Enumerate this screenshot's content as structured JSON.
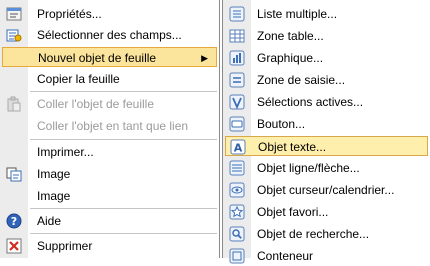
{
  "left_menu": {
    "items": [
      {
        "label": "Propriétés...",
        "icon": "properties-icon"
      },
      {
        "label": "Sélectionner des champs...",
        "icon": "select-fields-icon"
      },
      {
        "label": "Nouvel objet de feuille",
        "icon": "",
        "submenu_arrow": "▶"
      },
      {
        "label": "Copier la feuille",
        "icon": ""
      },
      {
        "label": "Coller l'objet de feuille",
        "icon": "paste-icon"
      },
      {
        "label": "Coller l'objet en tant que lien",
        "icon": ""
      },
      {
        "label": "Imprimer...",
        "icon": ""
      },
      {
        "label": "Image",
        "icon": "copy-image-icon"
      },
      {
        "label": "Image",
        "icon": ""
      },
      {
        "label": "Aide",
        "icon": "help-icon"
      },
      {
        "label": "Supprimer",
        "icon": "delete-icon"
      }
    ]
  },
  "right_menu": {
    "items": [
      {
        "label": "Liste multiple...",
        "icon": "multi-list-icon"
      },
      {
        "label": "Zone table...",
        "icon": "table-box-icon"
      },
      {
        "label": "Graphique...",
        "icon": "chart-icon"
      },
      {
        "label": "Zone de saisie...",
        "icon": "input-box-icon"
      },
      {
        "label": "Sélections actives...",
        "icon": "current-selections-icon"
      },
      {
        "label": "Bouton...",
        "icon": "button-icon"
      },
      {
        "label": "Objet texte...",
        "icon": "text-object-icon"
      },
      {
        "label": "Objet ligne/flèche...",
        "icon": "line-arrow-icon"
      },
      {
        "label": "Objet curseur/calendrier...",
        "icon": "slider-calendar-icon"
      },
      {
        "label": "Objet favori...",
        "icon": "bookmark-icon"
      },
      {
        "label": "Objet de recherche...",
        "icon": "search-object-icon"
      },
      {
        "label": "Conteneur",
        "icon": "container-icon"
      }
    ]
  },
  "colors": {
    "highlight_bg": "#fbe49b",
    "highlight_border": "#e7a93c",
    "disabled_text": "#9b9b9b",
    "icon_blue": "#3b6fb6"
  }
}
